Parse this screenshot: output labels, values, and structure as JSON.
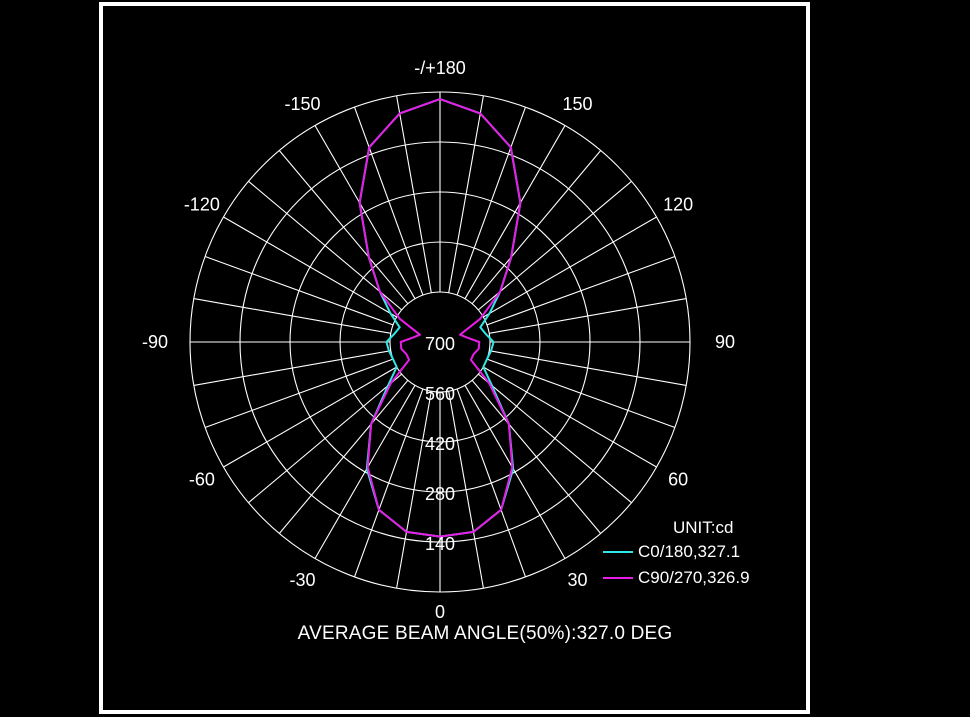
{
  "chart_data": {
    "type": "polar",
    "unit_label": "UNIT:cd",
    "angle_labels": [
      {
        "angle": 180,
        "text": "-/+180"
      },
      {
        "angle": -150,
        "text": "-150"
      },
      {
        "angle": 150,
        "text": "150"
      },
      {
        "angle": -120,
        "text": "-120"
      },
      {
        "angle": 120,
        "text": "120"
      },
      {
        "angle": -90,
        "text": "-90"
      },
      {
        "angle": 90,
        "text": "90"
      },
      {
        "angle": -60,
        "text": "-60"
      },
      {
        "angle": 60,
        "text": "60"
      },
      {
        "angle": -30,
        "text": "-30"
      },
      {
        "angle": 30,
        "text": "30"
      },
      {
        "angle": 0,
        "text": "0"
      }
    ],
    "radial_ticks": [
      140,
      280,
      420,
      560,
      700
    ],
    "radial_max": 700,
    "grid_angle_step_deg": 10,
    "series": [
      {
        "name": "C0/180,327.1",
        "color": "#33e6e6",
        "angles": [
          0,
          10,
          20,
          30,
          40,
          50,
          60,
          70,
          80,
          90,
          100,
          110,
          120,
          130,
          140,
          150,
          160,
          170,
          180
        ],
        "values": [
          155,
          160,
          200,
          290,
          400,
          510,
          560,
          560,
          555,
          550,
          570,
          580,
          540,
          480,
          390,
          250,
          120,
          50,
          20
        ]
      },
      {
        "name": "C90/270,326.9",
        "color": "#e61ee6",
        "angles": [
          0,
          10,
          20,
          30,
          40,
          50,
          60,
          70,
          80,
          90,
          100,
          110,
          120,
          130,
          140,
          150,
          160,
          170,
          180
        ],
        "values": [
          155,
          160,
          200,
          295,
          400,
          520,
          600,
          600,
          590,
          590,
          625,
          640,
          570,
          480,
          390,
          250,
          120,
          50,
          20
        ]
      }
    ],
    "caption": "AVERAGE BEAM ANGLE(50%):327.0 DEG"
  }
}
